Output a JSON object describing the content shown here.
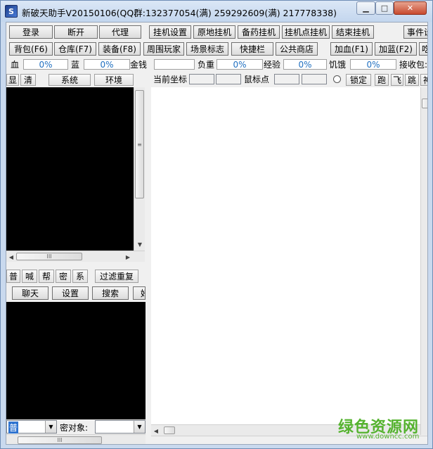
{
  "window": {
    "icon_letter": "S",
    "title": "新破天助手V20150106(QQ群:132377054(满) 259292609(满) 217778338)"
  },
  "toolbar_row1": {
    "login": "登录",
    "disconnect": "断开",
    "proxy": "代理",
    "hang_settings": "挂机设置",
    "local_hang": "原地挂机",
    "potion_hang": "备药挂机",
    "point_hang": "挂机点挂机",
    "stop_hang": "结束挂机",
    "events": "事件设"
  },
  "toolbar_row2": {
    "backpack": "背包(F6)",
    "warehouse": "仓库(F7)",
    "equipment": "装备(F8)",
    "nearby_players": "周围玩家",
    "scene_marker": "场景标志",
    "shortcut_bar": "快捷栏",
    "public_shop": "公共商店",
    "add_hp": "加血(F1)",
    "add_mp": "加蓝(F2)",
    "next_cut": "吃"
  },
  "stats": {
    "hp_label": "血",
    "hp_value": "0%",
    "mp_label": "蓝",
    "mp_value": "0%",
    "gold_label": "金钱",
    "gold_value": "",
    "weight_label": "负重",
    "weight_value": "0%",
    "exp_label": "经验",
    "exp_value": "0%",
    "hunger_label": "饥饿",
    "hunger_value": "0%",
    "receive_label": "接收包:"
  },
  "left_tabs": {
    "show": "显",
    "clear": "清",
    "system": "系统",
    "environment": "环境"
  },
  "chat_tabs": {
    "normal": "普",
    "shout": "喊",
    "guild": "帮",
    "secret": "密",
    "system": "系",
    "filter_repeat": "过滤重复"
  },
  "chat_buttons": {
    "chat": "聊天",
    "settings": "设置",
    "search": "搜索",
    "cut": "好"
  },
  "chat_input": {
    "channel": "普",
    "target_label": "密对象:",
    "target_value": ""
  },
  "map_header": {
    "current_coord_label": "当前坐标",
    "mouse_point_label": "鼠标点",
    "lock": "锁定",
    "run": "跑",
    "fly": "飞",
    "jump": "跳",
    "cut": "神"
  },
  "scrollbar_grip": "III",
  "scrollbar_grip_v": "≡",
  "watermark": {
    "text": "绿色资源网",
    "url": "www.downcc.com"
  }
}
